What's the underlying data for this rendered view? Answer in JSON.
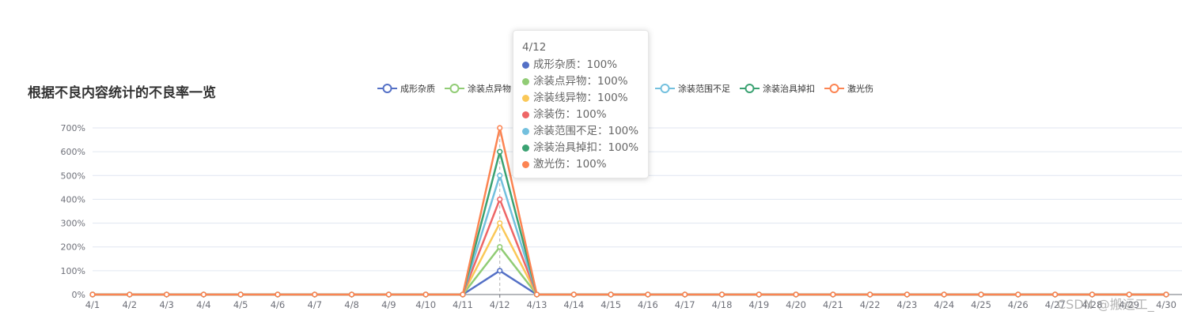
{
  "chart_data": {
    "type": "line",
    "title": "根据不良内容统计的不良率一览",
    "categories": [
      "4/1",
      "4/2",
      "4/3",
      "4/4",
      "4/5",
      "4/6",
      "4/7",
      "4/8",
      "4/9",
      "4/10",
      "4/11",
      "4/12",
      "4/13",
      "4/14",
      "4/15",
      "4/16",
      "4/17",
      "4/18",
      "4/19",
      "4/20",
      "4/21",
      "4/22",
      "4/23",
      "4/24",
      "4/25",
      "4/26",
      "4/27",
      "4/28",
      "4/29",
      "4/30"
    ],
    "y_ticks": [
      "0%",
      "100%",
      "200%",
      "300%",
      "400%",
      "500%",
      "600%",
      "700%"
    ],
    "ylim": [
      0,
      700
    ],
    "stacked": true,
    "grid": true,
    "legend_position": "top",
    "series": [
      {
        "name": "成形杂质",
        "color": "#5470c6",
        "values": [
          0,
          0,
          0,
          0,
          0,
          0,
          0,
          0,
          0,
          0,
          0,
          100,
          0,
          0,
          0,
          0,
          0,
          0,
          0,
          0,
          0,
          0,
          0,
          0,
          0,
          0,
          0,
          0,
          0,
          0
        ]
      },
      {
        "name": "涂装点异物",
        "color": "#91cc75",
        "values": [
          0,
          0,
          0,
          0,
          0,
          0,
          0,
          0,
          0,
          0,
          0,
          100,
          0,
          0,
          0,
          0,
          0,
          0,
          0,
          0,
          0,
          0,
          0,
          0,
          0,
          0,
          0,
          0,
          0,
          0
        ]
      },
      {
        "name": "涂装线异物",
        "color": "#fac858",
        "values": [
          0,
          0,
          0,
          0,
          0,
          0,
          0,
          0,
          0,
          0,
          0,
          100,
          0,
          0,
          0,
          0,
          0,
          0,
          0,
          0,
          0,
          0,
          0,
          0,
          0,
          0,
          0,
          0,
          0,
          0
        ]
      },
      {
        "name": "涂装伤",
        "color": "#ee6666",
        "values": [
          0,
          0,
          0,
          0,
          0,
          0,
          0,
          0,
          0,
          0,
          0,
          100,
          0,
          0,
          0,
          0,
          0,
          0,
          0,
          0,
          0,
          0,
          0,
          0,
          0,
          0,
          0,
          0,
          0,
          0
        ]
      },
      {
        "name": "涂装范围不足",
        "color": "#73c0de",
        "values": [
          0,
          0,
          0,
          0,
          0,
          0,
          0,
          0,
          0,
          0,
          0,
          100,
          0,
          0,
          0,
          0,
          0,
          0,
          0,
          0,
          0,
          0,
          0,
          0,
          0,
          0,
          0,
          0,
          0,
          0
        ]
      },
      {
        "name": "涂装治具掉扣",
        "color": "#3ba272",
        "values": [
          0,
          0,
          0,
          0,
          0,
          0,
          0,
          0,
          0,
          0,
          0,
          100,
          0,
          0,
          0,
          0,
          0,
          0,
          0,
          0,
          0,
          0,
          0,
          0,
          0,
          0,
          0,
          0,
          0,
          0
        ]
      },
      {
        "name": "激光伤",
        "color": "#fc8452",
        "values": [
          0,
          0,
          0,
          0,
          0,
          0,
          0,
          0,
          0,
          0,
          0,
          100,
          0,
          0,
          0,
          0,
          0,
          0,
          0,
          0,
          0,
          0,
          0,
          0,
          0,
          0,
          0,
          0,
          0,
          0
        ]
      }
    ]
  },
  "legend": {
    "items": [
      {
        "label": "成形杂质",
        "color": "#5470c6"
      },
      {
        "label": "涂装点异物",
        "color": "#91cc75"
      },
      {
        "label": "涂装线异物",
        "color": "#fac858"
      },
      {
        "label": "涂装伤",
        "color": "#ee6666"
      },
      {
        "label": "涂装范围不足",
        "color": "#73c0de"
      },
      {
        "label": "涂装治具掉扣",
        "color": "#3ba272"
      },
      {
        "label": "激光伤",
        "color": "#fc8452"
      }
    ]
  },
  "tooltip": {
    "title": "4/12",
    "rows": [
      {
        "label": "成形杂质：100%",
        "color": "#5470c6"
      },
      {
        "label": "涂装点异物：100%",
        "color": "#91cc75"
      },
      {
        "label": "涂装线异物：100%",
        "color": "#fac858"
      },
      {
        "label": "涂装伤：100%",
        "color": "#ee6666"
      },
      {
        "label": "涂装范围不足：100%",
        "color": "#73c0de"
      },
      {
        "label": "涂装治具掉扣：100%",
        "color": "#3ba272"
      },
      {
        "label": "激光伤：100%",
        "color": "#fc8452"
      }
    ]
  },
  "watermark": "CSDN @搬运工_"
}
